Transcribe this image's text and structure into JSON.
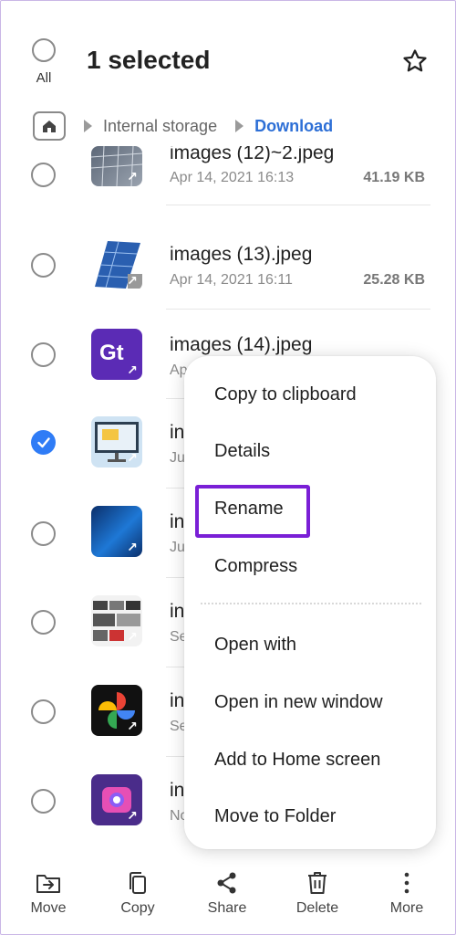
{
  "header": {
    "select_all_label": "All",
    "title": "1 selected"
  },
  "breadcrumb": {
    "items": [
      "Internal storage",
      "Download"
    ]
  },
  "files": [
    {
      "name": "images (12)~2.jpeg",
      "meta": "Apr 14, 2021 16:13",
      "size": "41.19 KB",
      "selected": false
    },
    {
      "name": "images (13).jpeg",
      "meta": "Apr 14, 2021 16:11",
      "size": "25.28 KB",
      "selected": false
    },
    {
      "name": "images (14).jpeg",
      "meta": "Ap",
      "size": "",
      "selected": false
    },
    {
      "name": "in",
      "meta": "Ju",
      "size": "",
      "selected": true
    },
    {
      "name": "in",
      "meta": "Ju",
      "size": "",
      "selected": false
    },
    {
      "name": "in",
      "meta": "Se",
      "size": "",
      "selected": false
    },
    {
      "name": "in",
      "meta": "Se",
      "size": "",
      "selected": false
    },
    {
      "name": "in",
      "meta": "No",
      "size": "",
      "selected": false
    }
  ],
  "menu": {
    "items": [
      "Copy to clipboard",
      "Details",
      "Rename",
      "Compress",
      "Open with",
      "Open in new window",
      "Add to Home screen",
      "Move to Folder"
    ],
    "highlighted": "Rename",
    "highlight_color": "#7a1fd6"
  },
  "bottom_bar": {
    "move": "Move",
    "copy": "Copy",
    "share": "Share",
    "delete": "Delete",
    "more": "More"
  },
  "colors": {
    "accent_blue": "#2d6fd6",
    "check_blue": "#2f7cf6"
  }
}
